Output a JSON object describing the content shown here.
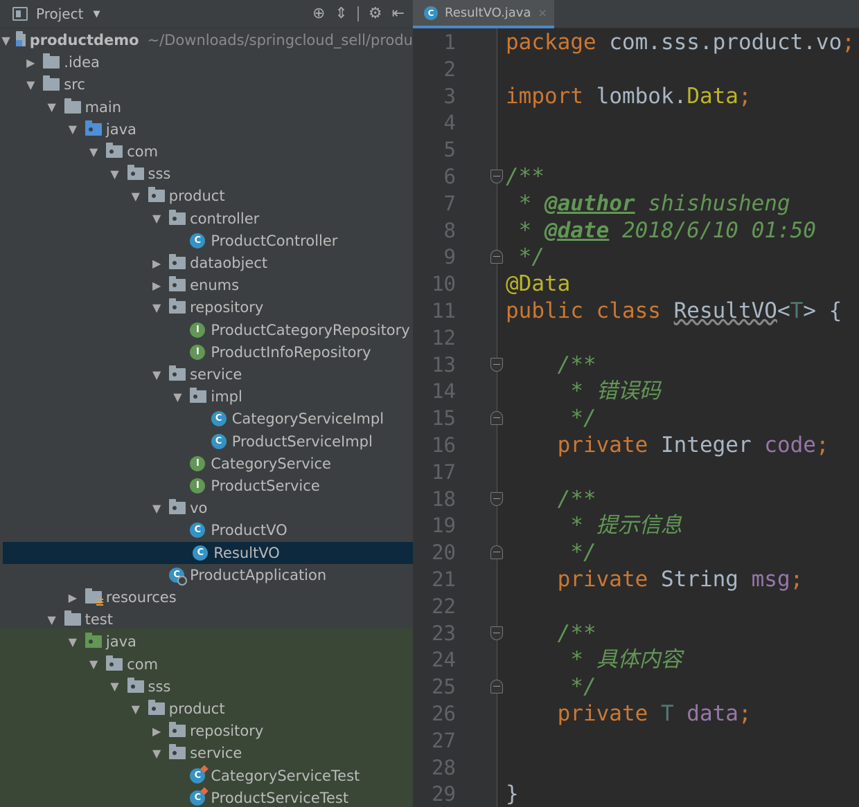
{
  "panel": {
    "title": "Project",
    "title_caret": "▼",
    "tool_icons": [
      "crosshair-icon",
      "collapse-all-icon",
      "gear-icon",
      "hide-panel-icon"
    ]
  },
  "tree": [
    {
      "label": "productdemo",
      "extra": "~/Downloads/springcloud_sell/produ",
      "type": "module",
      "depth": 0,
      "arrow": "down"
    },
    {
      "label": ".idea",
      "type": "folder",
      "depth": 1,
      "arrow": "right"
    },
    {
      "label": "src",
      "type": "folder",
      "depth": 1,
      "arrow": "down"
    },
    {
      "label": "main",
      "type": "folder",
      "depth": 2,
      "arrow": "down"
    },
    {
      "label": "java",
      "type": "src",
      "depth": 3,
      "arrow": "down"
    },
    {
      "label": "com",
      "type": "pkg",
      "depth": 4,
      "arrow": "down"
    },
    {
      "label": "sss",
      "type": "pkg",
      "depth": 5,
      "arrow": "down"
    },
    {
      "label": "product",
      "type": "pkg",
      "depth": 6,
      "arrow": "down"
    },
    {
      "label": "controller",
      "type": "pkg",
      "depth": 7,
      "arrow": "down"
    },
    {
      "label": "ProductController",
      "type": "class",
      "depth": 8,
      "arrow": "none"
    },
    {
      "label": "dataobject",
      "type": "pkg",
      "depth": 7,
      "arrow": "right"
    },
    {
      "label": "enums",
      "type": "pkg",
      "depth": 7,
      "arrow": "right"
    },
    {
      "label": "repository",
      "type": "pkg",
      "depth": 7,
      "arrow": "down"
    },
    {
      "label": "ProductCategoryRepository",
      "type": "iface",
      "depth": 8,
      "arrow": "none"
    },
    {
      "label": "ProductInfoRepository",
      "type": "iface",
      "depth": 8,
      "arrow": "none"
    },
    {
      "label": "service",
      "type": "pkg",
      "depth": 7,
      "arrow": "down"
    },
    {
      "label": "impl",
      "type": "pkg",
      "depth": 8,
      "arrow": "down"
    },
    {
      "label": "CategoryServiceImpl",
      "type": "class",
      "depth": 9,
      "arrow": "none"
    },
    {
      "label": "ProductServiceImpl",
      "type": "class",
      "depth": 9,
      "arrow": "none"
    },
    {
      "label": "CategoryService",
      "type": "iface",
      "depth": 8,
      "arrow": "none"
    },
    {
      "label": "ProductService",
      "type": "iface",
      "depth": 8,
      "arrow": "none"
    },
    {
      "label": "vo",
      "type": "pkg",
      "depth": 7,
      "arrow": "down"
    },
    {
      "label": "ProductVO",
      "type": "class",
      "depth": 8,
      "arrow": "none"
    },
    {
      "label": "ResultVO",
      "type": "class",
      "depth": 8,
      "arrow": "none",
      "selected": true
    },
    {
      "label": "ProductApplication",
      "type": "app",
      "depth": 7,
      "arrow": "none"
    },
    {
      "label": "resources",
      "type": "res",
      "depth": 3,
      "arrow": "right"
    },
    {
      "label": "test",
      "type": "folder",
      "depth": 2,
      "arrow": "down"
    },
    {
      "label": "java",
      "type": "test",
      "depth": 3,
      "arrow": "down"
    },
    {
      "label": "com",
      "type": "pkg",
      "depth": 4,
      "arrow": "down"
    },
    {
      "label": "sss",
      "type": "pkg",
      "depth": 5,
      "arrow": "down"
    },
    {
      "label": "product",
      "type": "pkg",
      "depth": 6,
      "arrow": "down"
    },
    {
      "label": "repository",
      "type": "pkg",
      "depth": 7,
      "arrow": "right"
    },
    {
      "label": "service",
      "type": "pkg",
      "depth": 7,
      "arrow": "down"
    },
    {
      "label": "CategoryServiceTest",
      "type": "testc",
      "depth": 8,
      "arrow": "none"
    },
    {
      "label": "ProductServiceTest",
      "type": "testc",
      "depth": 8,
      "arrow": "none"
    }
  ],
  "editor": {
    "tab": {
      "label": "ResultVO.java",
      "icon_letter": "C",
      "close": "×"
    },
    "class_icon_letter": "C",
    "interface_icon_letter": "I",
    "line_count": 29,
    "fold_markers": [
      {
        "line": 6,
        "kind": "open"
      },
      {
        "line": 9,
        "kind": "close"
      },
      {
        "line": 13,
        "kind": "open"
      },
      {
        "line": 15,
        "kind": "close"
      },
      {
        "line": 18,
        "kind": "open"
      },
      {
        "line": 20,
        "kind": "close"
      },
      {
        "line": 23,
        "kind": "open"
      },
      {
        "line": 25,
        "kind": "close"
      }
    ],
    "lines": [
      {
        "n": 1,
        "tokens": [
          {
            "t": "package ",
            "c": "kw"
          },
          {
            "t": "com.sss.product.vo",
            "c": ""
          },
          {
            "t": ";",
            "c": "kw"
          }
        ]
      },
      {
        "n": 2,
        "tokens": []
      },
      {
        "n": 3,
        "tokens": [
          {
            "t": "import ",
            "c": "kw"
          },
          {
            "t": "lombok.",
            "c": ""
          },
          {
            "t": "Data",
            "c": "ann"
          },
          {
            "t": ";",
            "c": "kw"
          }
        ]
      },
      {
        "n": 4,
        "tokens": []
      },
      {
        "n": 5,
        "tokens": []
      },
      {
        "n": 6,
        "tokens": [
          {
            "t": "/**",
            "c": "doc"
          }
        ]
      },
      {
        "n": 7,
        "tokens": [
          {
            "t": " * ",
            "c": "doc"
          },
          {
            "t": "@author",
            "c": "doctag"
          },
          {
            "t": " shishusheng",
            "c": "doc"
          }
        ]
      },
      {
        "n": 8,
        "tokens": [
          {
            "t": " * ",
            "c": "doc"
          },
          {
            "t": "@date",
            "c": "doctag"
          },
          {
            "t": " 2018/6/10 01:50",
            "c": "doc"
          }
        ]
      },
      {
        "n": 9,
        "tokens": [
          {
            "t": " */",
            "c": "doc"
          }
        ]
      },
      {
        "n": 10,
        "tokens": [
          {
            "t": "@Data",
            "c": "ann"
          }
        ]
      },
      {
        "n": 11,
        "tokens": [
          {
            "t": "public class ",
            "c": "kw"
          },
          {
            "t": "ResultVO",
            "c": "squig"
          },
          {
            "t": "<",
            "c": ""
          },
          {
            "t": "T",
            "c": "tparam"
          },
          {
            "t": "> {",
            "c": ""
          }
        ]
      },
      {
        "n": 12,
        "tokens": []
      },
      {
        "n": 13,
        "tokens": [
          {
            "t": "    /**",
            "c": "doc"
          }
        ]
      },
      {
        "n": 14,
        "tokens": [
          {
            "t": "     * 错误码",
            "c": "doc"
          }
        ]
      },
      {
        "n": 15,
        "tokens": [
          {
            "t": "     */",
            "c": "doc"
          }
        ]
      },
      {
        "n": 16,
        "tokens": [
          {
            "t": "    private ",
            "c": "kw"
          },
          {
            "t": "Integer ",
            "c": ""
          },
          {
            "t": "code",
            "c": "field"
          },
          {
            "t": ";",
            "c": "kw"
          }
        ]
      },
      {
        "n": 17,
        "tokens": []
      },
      {
        "n": 18,
        "tokens": [
          {
            "t": "    /**",
            "c": "doc"
          }
        ]
      },
      {
        "n": 19,
        "tokens": [
          {
            "t": "     * 提示信息",
            "c": "doc"
          }
        ]
      },
      {
        "n": 20,
        "tokens": [
          {
            "t": "     */",
            "c": "doc"
          }
        ]
      },
      {
        "n": 21,
        "tokens": [
          {
            "t": "    private ",
            "c": "kw"
          },
          {
            "t": "String ",
            "c": ""
          },
          {
            "t": "msg",
            "c": "field"
          },
          {
            "t": ";",
            "c": "kw"
          }
        ]
      },
      {
        "n": 22,
        "tokens": []
      },
      {
        "n": 23,
        "tokens": [
          {
            "t": "    /**",
            "c": "doc"
          }
        ]
      },
      {
        "n": 24,
        "tokens": [
          {
            "t": "     * 具体内容",
            "c": "doc"
          }
        ]
      },
      {
        "n": 25,
        "tokens": [
          {
            "t": "     */",
            "c": "doc"
          }
        ]
      },
      {
        "n": 26,
        "tokens": [
          {
            "t": "    private ",
            "c": "kw"
          },
          {
            "t": "T ",
            "c": "tparam"
          },
          {
            "t": "data",
            "c": "field"
          },
          {
            "t": ";",
            "c": "kw"
          }
        ]
      },
      {
        "n": 27,
        "tokens": []
      },
      {
        "n": 28,
        "tokens": []
      },
      {
        "n": 29,
        "tokens": [
          {
            "t": "}",
            "c": ""
          }
        ]
      }
    ]
  },
  "colors": {
    "panel_bg": "#3c3f41",
    "editor_bg": "#2b2b2b",
    "selection": "#0d293e",
    "test_zone": "#3a4736",
    "keyword": "#cc7832",
    "annotation": "#bbb529",
    "doc_comment": "#629755",
    "field": "#9876aa"
  }
}
